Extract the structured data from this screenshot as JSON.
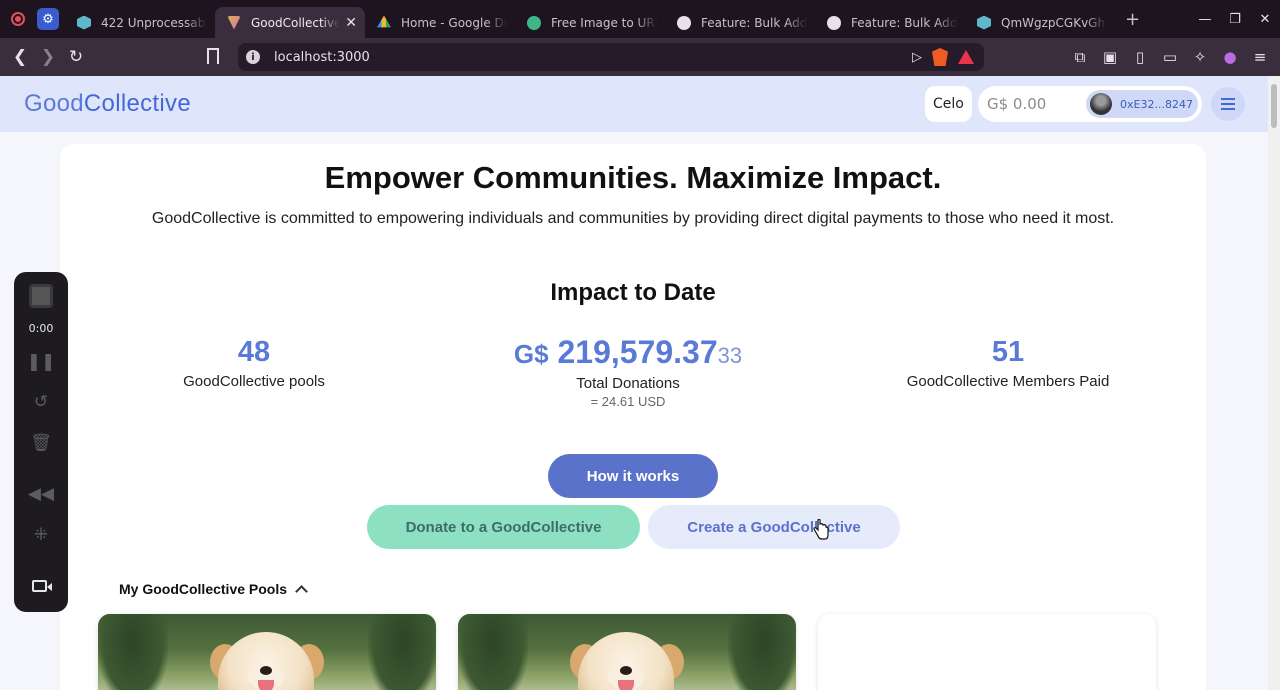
{
  "browser": {
    "tabs": [
      {
        "label": "422 Unprocessable",
        "icon": "hexagon-icon",
        "color": "#5fb8c9",
        "active": false
      },
      {
        "label": "GoodCollective",
        "icon": "goodcollective-icon",
        "color": "#e0b63a",
        "active": true
      },
      {
        "label": "Home - Google Dri",
        "icon": "google-drive-icon",
        "color": "#f2b632",
        "active": false
      },
      {
        "label": "Free Image to URL",
        "icon": "image-host-icon",
        "color": "#3fb68a",
        "active": false
      },
      {
        "label": "Feature: Bulk Add",
        "icon": "github-icon",
        "color": "#e8e0ea",
        "active": false
      },
      {
        "label": "Feature: Bulk Add",
        "icon": "github-icon",
        "color": "#e8e0ea",
        "active": false
      },
      {
        "label": "QmWgzpCGKvGhK",
        "icon": "hexagon-icon",
        "color": "#5fb8c9",
        "active": false
      }
    ],
    "new_tab": "+",
    "url": "localhost:3000",
    "shield_count": "1"
  },
  "header": {
    "logo_prefix": "Good",
    "logo_suffix": "Collective",
    "chain": "Celo",
    "balance": "G$ 0.00",
    "address": "0xE32...8247"
  },
  "hero": {
    "title": "Empower Communities. Maximize Impact.",
    "subtitle": "GoodCollective is committed to empowering individuals and communities by providing direct digital payments to those who need it most."
  },
  "impact": {
    "title": "Impact to Date",
    "pools_value": "48",
    "pools_label": "GoodCollective pools",
    "donations_currency": "G$",
    "donations_value": "219,579.37",
    "donations_decimals": "33",
    "donations_label": "Total Donations",
    "donations_usd": "= 24.61 USD",
    "members_value": "51",
    "members_label": "GoodCollective Members Paid"
  },
  "actions": {
    "how_it_works": "How it works",
    "donate": "Donate to a GoodCollective",
    "create": "Create a GoodCollective"
  },
  "my_pools": {
    "title": "My GoodCollective Pools"
  },
  "recorder": {
    "time": "0:00"
  },
  "colors": {
    "brand_blue": "#5a7ad8",
    "button_blue": "#5a72c9",
    "donate_green": "#8ee0c2",
    "header_bg": "#dfe6fb"
  }
}
